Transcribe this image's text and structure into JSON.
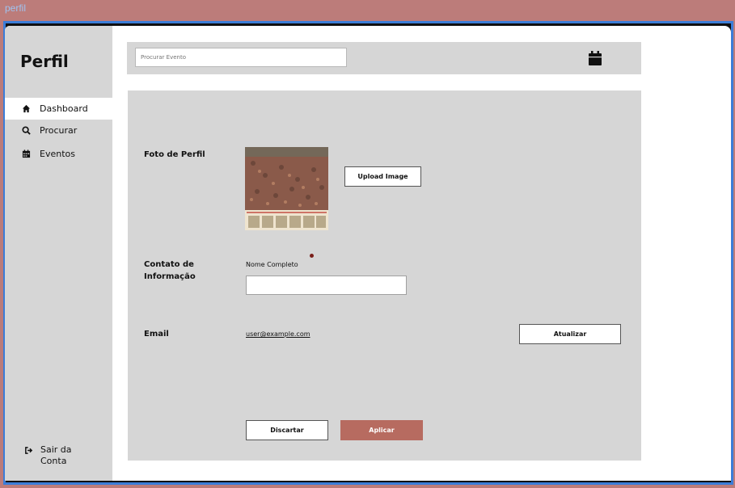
{
  "page": {
    "label": "perfil"
  },
  "sidebar": {
    "brand": "Perfil",
    "items": [
      {
        "label": "Dashboard",
        "icon": "home-icon"
      },
      {
        "label": "Procurar",
        "icon": "search-icon"
      },
      {
        "label": "Eventos",
        "icon": "calendar-icon"
      }
    ],
    "logout": {
      "line1": "Sair da",
      "line2": "Conta",
      "icon": "logout-icon"
    }
  },
  "topbar": {
    "search_placeholder": "Procurar Evento",
    "calendar_icon": "calendar-icon"
  },
  "profile": {
    "photo_label": "Foto de Perfil",
    "upload_label": "Upload Image",
    "contact_label_1": "Contato de",
    "contact_label_2": "Informação",
    "name_label": "Nome Completo",
    "name_value": "",
    "email_label": "Email",
    "email_value": "user@example.com",
    "update_label": "Atualizar",
    "discard_label": "Discartar",
    "apply_label": "Aplicar"
  },
  "colors": {
    "accent": "#b76b60",
    "background": "#bc7c7a",
    "panel": "#d6d6d6",
    "frame_border": "#3b7dd8"
  }
}
